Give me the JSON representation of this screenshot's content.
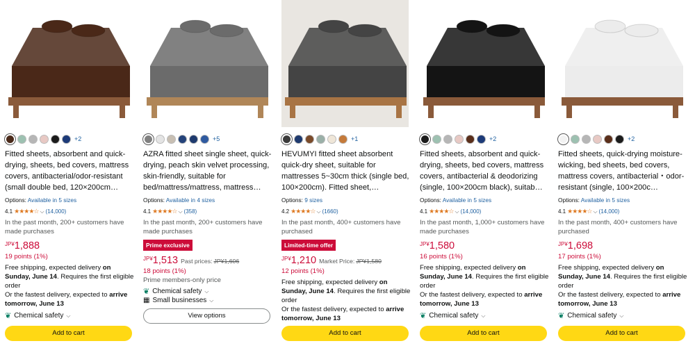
{
  "products": [
    {
      "swatches": [
        "#4a2a1a",
        "#9dc1b1",
        "#b6b6b6",
        "#e8c9c4",
        "#1b1b1b",
        "#1c3a78"
      ],
      "more": "+2",
      "title": "Fitted sheets, absorbent and quick-drying, sheets, bed covers, mattress covers, antibacterial/odor-resistant (small double bed, 120×200cm…",
      "options_label": "Options: ",
      "options_link": "Available in 5 sizes",
      "rating": "4.1",
      "stars": "★★★★☆",
      "review_count": "(14,000)",
      "bought": "In the past month, 200+ customers have made purchases",
      "currency": "JP¥",
      "price": "1,888",
      "points": "19 points (1%)",
      "ship1": "Free shipping, expected delivery ",
      "ship1_bold": "on Sunday, June 14",
      "ship2": ". Requires the first eligible order",
      "fast1": "Or the fastest delivery, expected to ",
      "fast_bold": "arrive tomorrow, June 13",
      "feature": "Chemical safety",
      "cart": "Add to cart",
      "image": {
        "sheet": "#4a2818",
        "bg": "#ffffff",
        "frame": "#8a5a3a"
      }
    },
    {
      "swatches": [
        "#808080",
        "#e4e4e4",
        "#c8bfb3",
        "#24437a",
        "#1e3a6e",
        "#2f5aa0"
      ],
      "more": "+5",
      "title": "AZRA fitted sheet single sheet, quick-drying, peach skin velvet processing, skin-friendly, suitable for bed/mattress/mattress, mattress…",
      "options_label": "Options: ",
      "options_link": "Available in 4 sizes",
      "rating": "4.1",
      "stars": "★★★★☆",
      "review_count": "(358)",
      "bought": "In the past month, 200+ customers have made purchases",
      "badge": "Prime exclusive",
      "currency": "JP¥",
      "price": "1,513",
      "past_label": "Past prices:",
      "past_price": "JP¥1,606",
      "points": "18 points (1%)",
      "misc": "Prime members-only price",
      "feature": "Chemical safety",
      "feature2": "Small businesses",
      "view_options": "View options",
      "image": {
        "sheet": "#6b6b6b",
        "bg": "#ffffff",
        "frame": "#b08658"
      }
    },
    {
      "swatches": [
        "#3b3b3b",
        "#1e3a6e",
        "#7a4a2a",
        "#9ab0a8",
        "#efe6d8",
        "#c57a3a"
      ],
      "more": "+1",
      "title": "HEVUMYI fitted sheet absorbent quick-dry sheet, suitable for mattresses 5~30cm thick (single bed, 100×200cm). Fitted sheet,…",
      "options_label": "Options: ",
      "options_link": "9 sizes",
      "rating": "4.2",
      "stars": "★★★★☆",
      "review_count": "(1660)",
      "bought": "In the past month, 400+ customers have purchased",
      "badge": "Limited-time offer",
      "currency": "JP¥",
      "price": "1,210",
      "past_label": "Market Price:",
      "past_price": "JP¥1,580",
      "points": "12 points (1%)",
      "ship1": "Free shipping, expected delivery ",
      "ship1_bold": "on Sunday, June 14",
      "ship2": ". Requires the first eligible order",
      "fast1": "Or the fastest delivery, expected to ",
      "fast_bold": "arrive tomorrow, June 13",
      "cart": "Add to cart",
      "image": {
        "sheet": "#444444",
        "bg": "#e9e6e1",
        "frame": "#a87444"
      }
    },
    {
      "swatches": [
        "#1b1b1b",
        "#9dc1b1",
        "#b6b6b6",
        "#e8c9c4",
        "#5a2e1a",
        "#1c3a78"
      ],
      "more": "+2",
      "title": "Fitted sheets, absorbent and quick-drying, sheets, bed covers, mattress covers, antibacterial & deodorizing (single, 100×200cm black), suitab…",
      "options_label": "Options: ",
      "options_link": "Available in 5 sizes",
      "rating": "4.1",
      "stars": "★★★★☆",
      "review_count": "(14,000)",
      "bought": "In the past month, 1,000+ customers have made purchases",
      "currency": "JP¥",
      "price": "1,580",
      "points": "16 points (1%)",
      "ship1": "Free shipping, expected delivery ",
      "ship1_bold": "on Sunday, June 14",
      "ship2": ". Requires the first eligible order",
      "fast1": "Or the fastest delivery, expected to ",
      "fast_bold": "arrive tomorrow, June 13",
      "feature": "Chemical safety",
      "cart": "Add to cart",
      "image": {
        "sheet": "#141414",
        "bg": "#ffffff",
        "frame": "#8a5a3a"
      }
    },
    {
      "swatches": [
        "#f2f2f2",
        "#9dc1b1",
        "#b6b6b6",
        "#e8c9c4",
        "#5a2e1a",
        "#1b1b1b"
      ],
      "more": "+2",
      "title": "Fitted sheets, quick-drying moisture-wicking, bed sheets, bed covers, mattress covers, antibacterial・odor-resistant (single, 100×200c…",
      "options_label": "Options: ",
      "options_link": "Available in 5 sizes",
      "rating": "4.1",
      "stars": "★★★★☆",
      "review_count": "(14,000)",
      "bought": "In the past month, 400+ customers have purchased",
      "currency": "JP¥",
      "price": "1,698",
      "points": "17 points (1%)",
      "ship1": "Free shipping, expected delivery ",
      "ship1_bold": "on Sunday, June 14",
      "ship2": ". Requires the first eligible order",
      "fast1": "Or the fastest delivery, expected to ",
      "fast_bold": "arrive tomorrow, June 13",
      "feature": "Chemical safety",
      "cart": "Add to cart",
      "image": {
        "sheet": "#ececec",
        "bg": "#ffffff",
        "frame": "#8a5a3a"
      }
    }
  ]
}
